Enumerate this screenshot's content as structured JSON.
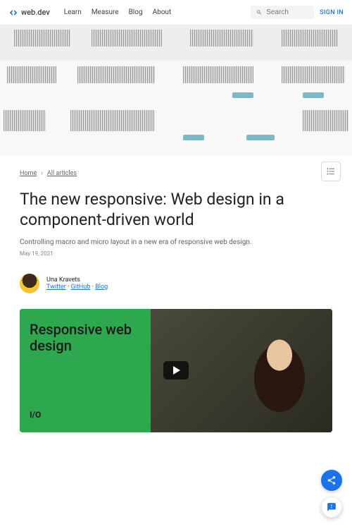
{
  "header": {
    "logo_text": "web.dev",
    "nav": [
      "Learn",
      "Measure",
      "Blog",
      "About"
    ],
    "search_placeholder": "Search",
    "signin": "SIGN IN"
  },
  "breadcrumb": {
    "home": "Home",
    "all_articles": "All articles"
  },
  "article": {
    "title": "The new responsive: Web design in a component-driven world",
    "subtitle": "Controlling macro and micro layout in a new era of responsive web design.",
    "date": "May 19, 2021"
  },
  "author": {
    "name": "Una Kravets",
    "links": {
      "twitter": "Twitter",
      "github": "GitHub",
      "blog": "Blog"
    },
    "sep": " · "
  },
  "video": {
    "title": "Responsive web design",
    "badge": "I/O"
  }
}
